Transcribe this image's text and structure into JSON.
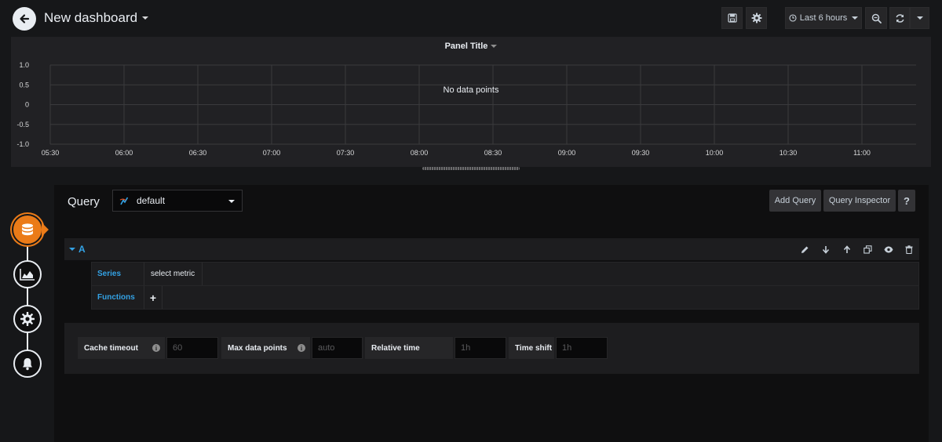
{
  "navbar": {
    "title": "New dashboard",
    "time_range": "Last 6 hours"
  },
  "panel": {
    "title": "Panel Title",
    "no_data": "No data points"
  },
  "chart_data": {
    "type": "line",
    "title": "Panel Title",
    "x_ticks": [
      "05:30",
      "06:00",
      "06:30",
      "07:00",
      "07:30",
      "08:00",
      "08:30",
      "09:00",
      "09:30",
      "10:00",
      "10:30",
      "11:00"
    ],
    "y_ticks": [
      "1.0",
      "0.5",
      "0",
      "-0.5",
      "-1.0"
    ],
    "ylim": [
      -1,
      1
    ],
    "series": [],
    "grid": true,
    "annotation": "No data points"
  },
  "query_editor": {
    "label": "Query",
    "datasource": "default",
    "add_query": "Add Query",
    "query_inspector": "Query Inspector",
    "help": "?"
  },
  "query_row": {
    "ref_id": "A",
    "series_label": "Series",
    "series_value": "select metric",
    "functions_label": "Functions",
    "functions_add": "+"
  },
  "options": {
    "cache_timeout_label": "Cache timeout",
    "cache_timeout_placeholder": "60",
    "max_data_points_label": "Max data points",
    "max_data_points_placeholder": "auto",
    "relative_time_label": "Relative time",
    "relative_time_placeholder": "1h",
    "time_shift_label": "Time shift",
    "time_shift_placeholder": "1h",
    "info_glyph": "i"
  },
  "colors": {
    "accent": "#eb7b18",
    "link": "#33a2e5",
    "background": "#161719",
    "panel": "#212124"
  }
}
